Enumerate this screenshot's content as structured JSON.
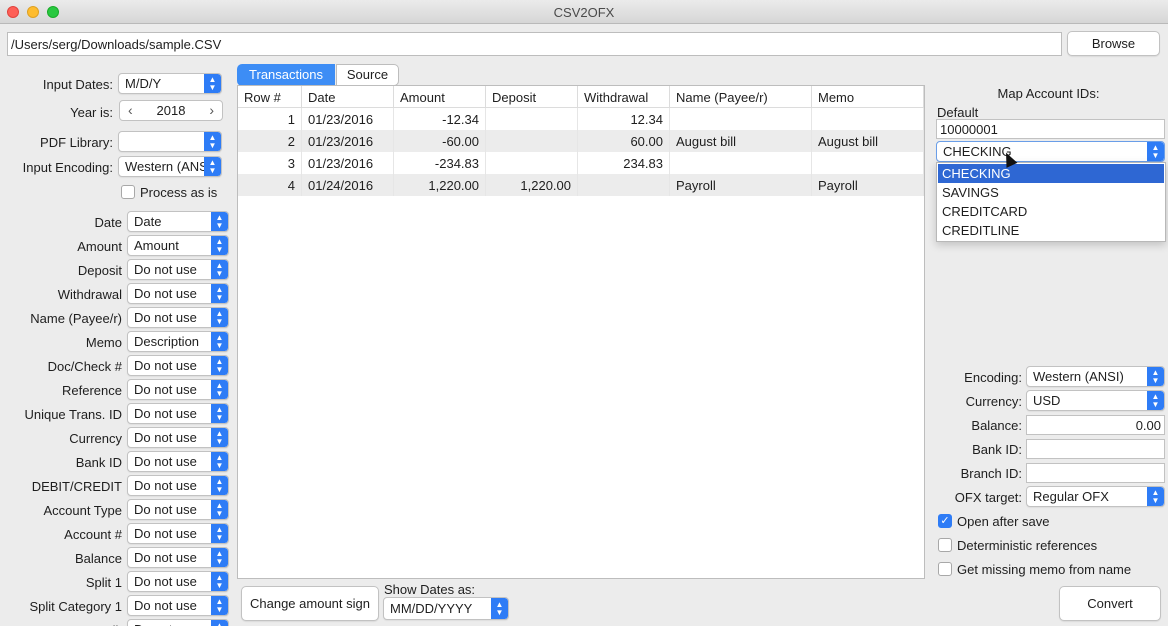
{
  "window": {
    "title": "CSV2OFX"
  },
  "file": {
    "path": "/Users/serg/Downloads/sample.CSV",
    "browse_label": "Browse"
  },
  "left": {
    "input_dates_label": "Input Dates:",
    "input_dates_value": "M/D/Y",
    "year_label": "Year is:",
    "year_value": "2018",
    "pdf_label": "PDF Library:",
    "pdf_value": "",
    "encoding_label": "Input Encoding:",
    "encoding_value": "Western (ANS",
    "process_label": "Process as is",
    "mappings": [
      {
        "label": "Date",
        "value": "Date"
      },
      {
        "label": "Amount",
        "value": "Amount"
      },
      {
        "label": "Deposit",
        "value": "Do not use"
      },
      {
        "label": "Withdrawal",
        "value": "Do not use"
      },
      {
        "label": "Name (Payee/r)",
        "value": "Do not use"
      },
      {
        "label": "Memo",
        "value": "Description"
      },
      {
        "label": "Doc/Check #",
        "value": "Do not use"
      },
      {
        "label": "Reference",
        "value": "Do not use"
      },
      {
        "label": "Unique Trans. ID",
        "value": "Do not use"
      },
      {
        "label": "Currency",
        "value": "Do not use"
      },
      {
        "label": "Bank ID",
        "value": "Do not use"
      },
      {
        "label": "DEBIT/CREDIT",
        "value": "Do not use"
      },
      {
        "label": "Account Type",
        "value": "Do not use"
      },
      {
        "label": "Account #",
        "value": "Do not use"
      },
      {
        "label": "Balance",
        "value": "Do not use"
      },
      {
        "label": "Split 1",
        "value": "Do not use"
      },
      {
        "label": "Split Category 1",
        "value": "Do not use"
      },
      {
        "label": "Split",
        "value": "Do not use"
      }
    ]
  },
  "tabs": [
    "Transactions",
    "Source"
  ],
  "table": {
    "headers": [
      "Row #",
      "Date",
      "Amount",
      "Deposit",
      "Withdrawal",
      "Name (Payee/r)",
      "Memo"
    ],
    "rows": [
      [
        "1",
        "01/23/2016",
        "-12.34",
        "",
        "12.34",
        "",
        ""
      ],
      [
        "2",
        "01/23/2016",
        "-60.00",
        "",
        "60.00",
        "August bill",
        "August bill"
      ],
      [
        "3",
        "01/23/2016",
        "-234.83",
        "",
        "234.83",
        "",
        ""
      ],
      [
        "4",
        "01/24/2016",
        "1,220.00",
        "1,220.00",
        "",
        "Payroll",
        "Payroll"
      ]
    ]
  },
  "bottom": {
    "change_sign_label": "Change amount sign",
    "show_dates_label": "Show Dates as:",
    "show_dates_value": "MM/DD/YYYY"
  },
  "right": {
    "map_title": "Map Account IDs:",
    "default_label": "Default",
    "account_id": "10000001",
    "account_type_value": "CHECKING",
    "account_type_options": [
      "CHECKING",
      "SAVINGS",
      "CREDITCARD",
      "CREDITLINE"
    ],
    "encoding_label": "Encoding:",
    "encoding_value": "Western (ANSI)",
    "currency_label": "Currency:",
    "currency_value": "USD",
    "balance_label": "Balance:",
    "balance_value": "0.00",
    "bankid_label": "Bank ID:",
    "bankid_value": "",
    "branchid_label": "Branch ID:",
    "branchid_value": "",
    "ofx_label": "OFX target:",
    "ofx_value": "Regular OFX",
    "open_after_save_label": "Open after save",
    "open_after_save_checked": true,
    "deterministic_label": "Deterministic references",
    "deterministic_checked": false,
    "missing_memo_label": "Get missing memo from name",
    "missing_memo_checked": false,
    "convert_label": "Convert"
  }
}
